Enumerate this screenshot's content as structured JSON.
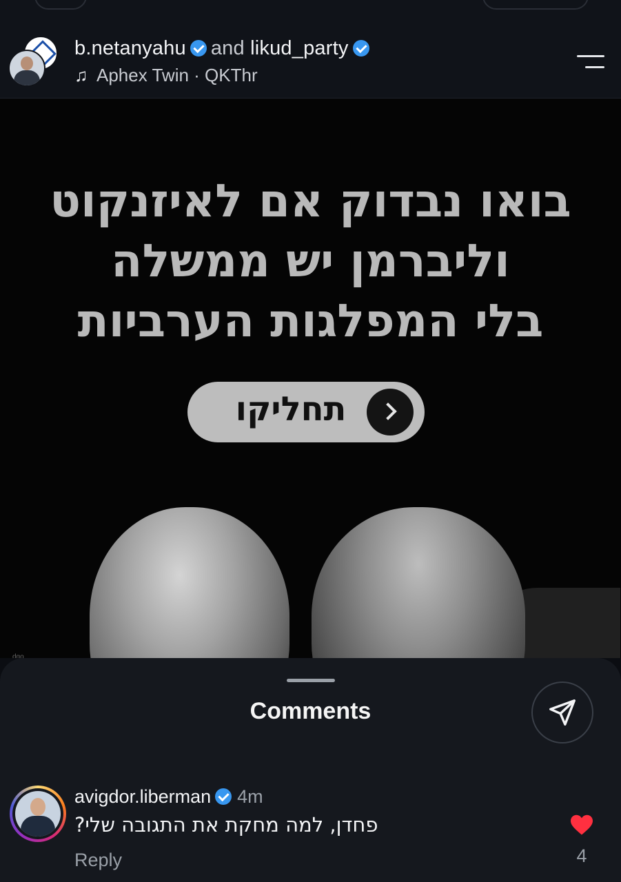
{
  "post_header": {
    "user1": "b.netanyahu",
    "connector": "and",
    "user2": "likud_party",
    "music": "Aphex Twin · QKThr"
  },
  "post_image": {
    "headline_lines": [
      "בואו נבדוק אם לאיזנקוט",
      "וליברמן יש ממשלה",
      "בלי המפלגות הערביות"
    ],
    "cta_label": "תחליקו",
    "watermark": "dgo"
  },
  "comments_sheet": {
    "title": "Comments",
    "comment": {
      "username": "avigdor.liberman",
      "time": "4m",
      "text": "פחדן, למה מחקת את התגובה שלי?",
      "reply_label": "Reply",
      "like_count": "4"
    }
  },
  "colors": {
    "verified": "#3897f0",
    "like": "#ff3040",
    "background": "#0b0d12"
  }
}
